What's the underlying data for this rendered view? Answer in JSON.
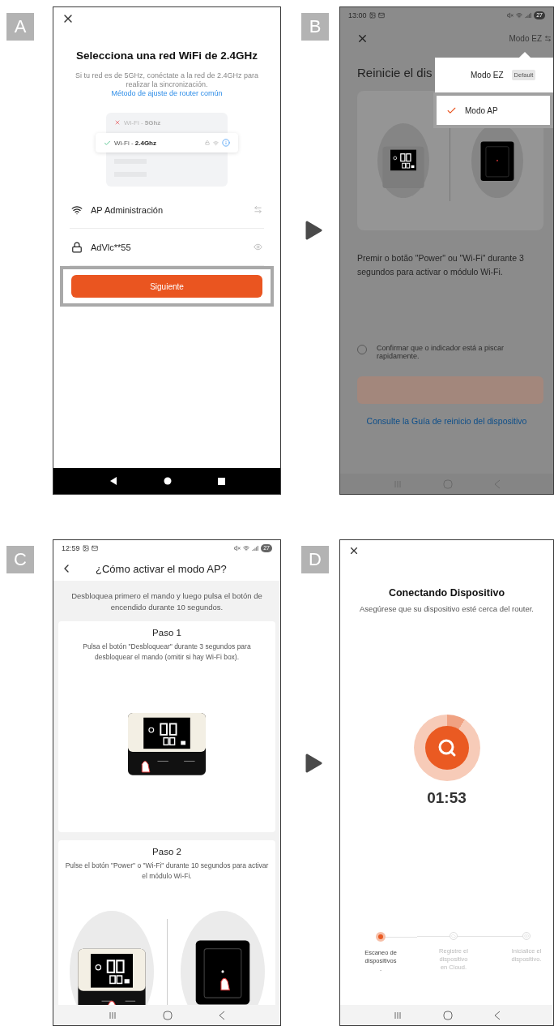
{
  "screen_a": {
    "tag": "A",
    "title": "Selecciona una red WiFi de 2.4GHz",
    "description": "Si tu red es de 5GHz, conéctate a la red de 2.4GHz para realizar la sincronización.",
    "link": "Método de ajuste de router común",
    "networks": [
      {
        "label": "Wi-Fi - **5Ghz**",
        "selected": false
      },
      {
        "label": "Wi-Fi - **2.4Ghz**",
        "selected": true
      }
    ],
    "network_field": {
      "value": "AP Administración"
    },
    "password_field": {
      "value": "AdVlc**55"
    },
    "button": "Siguiente"
  },
  "screen_b": {
    "tag": "B",
    "status_bar": {
      "time": "13:00",
      "battery": "27"
    },
    "mode_button": "Modo EZ",
    "title": "Reinicie el dis",
    "instructions": "Premir o botão \"Power\" ou \"Wi-Fi\" durante 3 segundos para activar o módulo Wi-Fi.",
    "confirm": {
      "label": "Confirmar que o indicador está a piscar rapidamente.",
      "checked": false
    },
    "button": {
      "disabled": true
    },
    "link": "Consulte la Guía de reinicio del dispositivo",
    "menu": [
      {
        "label": "Modo EZ",
        "badge": "Default",
        "selected": false
      },
      {
        "label": "Modo AP",
        "selected": true
      }
    ]
  },
  "screen_c": {
    "tag": "C",
    "status_bar": {
      "time": "12:59",
      "battery": "27"
    },
    "title": "¿Cómo activar el modo AP?",
    "intro": "Desbloquea primero el mando y luego pulsa el botón de encendido durante 10 segundos.",
    "steps": [
      {
        "kind": "single",
        "title": "Paso 1",
        "text": "Pulsa el botón \"Desbloquear\" durante 3 segundos para desbloquear el mando (omitir si hay Wi-Fi box)."
      },
      {
        "kind": "pair",
        "title": "Paso 2",
        "text": "Pulse el botón \"Power\" o \"Wi-Fi\" durante 10 segundos para activar el módulo Wi-Fi."
      }
    ]
  },
  "screen_d": {
    "tag": "D",
    "title": "Conectando Dispositivo",
    "description": "Asegúrese que su dispositivo esté cerca del router.",
    "timer": "01:53",
    "stages": [
      {
        "label": "Escaneo de\ndispositivos\n.",
        "active": true
      },
      {
        "label": "Registre el\ndispositivo\nen Cloud.",
        "active": false
      },
      {
        "label": "Inicialice el\ndispositivo.",
        "active": false
      }
    ]
  }
}
